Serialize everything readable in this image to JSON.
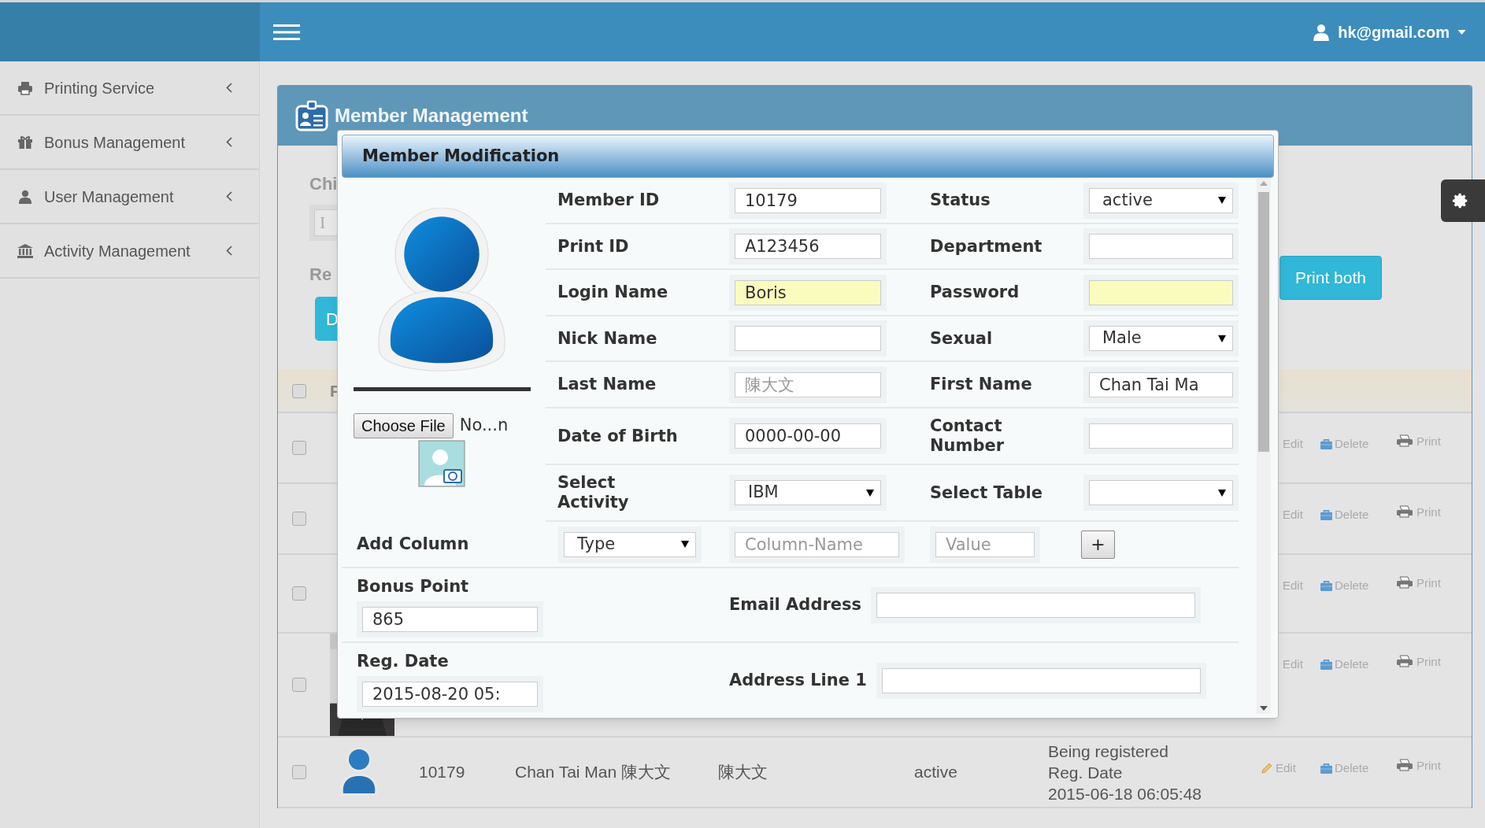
{
  "header": {
    "user": "hk@gmail.com"
  },
  "sidebar": {
    "items": [
      {
        "label": "Printing Service"
      },
      {
        "label": "Bonus Management"
      },
      {
        "label": "User Management"
      },
      {
        "label": "Activity Management"
      }
    ]
  },
  "panel": {
    "title": "Member Management",
    "filter_label": "Chi",
    "filter_placeholder": "I",
    "records_label": "Re",
    "primary_button": "D",
    "print_button": "Print both"
  },
  "table": {
    "header_checked": false,
    "header_label": "F",
    "rows": [
      {
        "kind": "covered",
        "checked": false,
        "actions": [
          "Edit",
          "Delete",
          "Print"
        ]
      },
      {
        "kind": "covered",
        "checked": false,
        "actions": [
          "Edit",
          "Delete",
          "Print"
        ]
      },
      {
        "kind": "covered",
        "checked": false,
        "actions": [
          "Edit",
          "Delete",
          "Print"
        ]
      },
      {
        "checked": false,
        "actions": [
          "Edit",
          "Delete",
          "Print"
        ]
      },
      {
        "kind": "full",
        "checked": false,
        "id": "10179",
        "name": "Chan Tai Man 陳大文",
        "last_name": "陳大文",
        "status": "active",
        "info": [
          "Being registered",
          "Reg. Date",
          "2015-06-18 06:05:48"
        ],
        "actions": [
          "Edit",
          "Delete",
          "Print"
        ]
      }
    ]
  },
  "modal": {
    "title": "Member Modification",
    "file_button": "Choose File",
    "file_name": "No...n",
    "grid": [
      [
        {
          "label": "Member ID",
          "kind": "text",
          "value": "10179",
          "autofilled": false
        },
        {
          "label": "Status",
          "kind": "select",
          "value": "active",
          "autofilled": false
        }
      ],
      [
        {
          "label": "Print ID",
          "kind": "text",
          "value": "A123456",
          "autofilled": false
        },
        {
          "label": "Department",
          "kind": "text",
          "autofilled": false
        }
      ],
      [
        {
          "label": "Login Name",
          "kind": "text",
          "value": "Boris",
          "autofilled": true
        },
        {
          "label": "Password",
          "kind": "text",
          "autofilled": true
        }
      ],
      [
        {
          "label": "Nick Name",
          "kind": "text",
          "autofilled": false
        },
        {
          "label": "Sexual",
          "kind": "select",
          "value": "Male",
          "autofilled": false
        }
      ],
      [
        {
          "label": "Last Name",
          "kind": "text",
          "placeholder": "陳大文",
          "autofilled": false
        },
        {
          "label": "First Name",
          "kind": "text",
          "value": "Chan Tai Ma",
          "autofilled": false
        }
      ],
      [
        {
          "label": "Date of Birth",
          "kind": "text",
          "value": "0000-00-00",
          "autofilled": false
        },
        {
          "label": "Contact Number",
          "kind": "text",
          "autofilled": false
        }
      ],
      [
        {
          "label": "Select Activity",
          "kind": "select",
          "value": "IBM",
          "autofilled": false
        },
        {
          "label": "Select Table",
          "kind": "select",
          "autofilled": false
        }
      ]
    ],
    "add_column": {
      "label": "Add Column",
      "type": "Type",
      "name_placeholder": "Column-Name",
      "value_placeholder": "Value",
      "add_button": "+"
    },
    "bonus": {
      "label": "Bonus Point",
      "value": "865"
    },
    "email": {
      "label": "Email Address"
    },
    "reg_date": {
      "label": "Reg. Date",
      "value": "2015-08-20 05:"
    },
    "address": {
      "label": "Address Line 1"
    }
  }
}
